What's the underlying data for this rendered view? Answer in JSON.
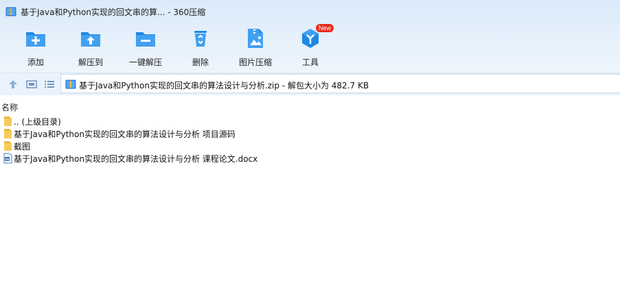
{
  "window": {
    "title": "基于Java和Python实现的回文串的算... - 360压缩"
  },
  "toolbar": {
    "items": [
      {
        "label": "添加",
        "icon": "add-icon"
      },
      {
        "label": "解压到",
        "icon": "extract-to-icon"
      },
      {
        "label": "一键解压",
        "icon": "one-click-extract-icon"
      },
      {
        "label": "删除",
        "icon": "delete-icon"
      },
      {
        "label": "图片压缩",
        "icon": "image-compress-icon"
      },
      {
        "label": "工具",
        "icon": "tools-icon",
        "badge": "New"
      }
    ]
  },
  "address": {
    "text": "基于Java和Python实现的回文串的算法设计与分析.zip - 解包大小为 482.7 KB"
  },
  "columns": {
    "name": "名称"
  },
  "files": [
    {
      "name": ".. (上级目录)",
      "type": "folder"
    },
    {
      "name": "基于Java和Python实现的回文串的算法设计与分析 项目源码",
      "type": "folder"
    },
    {
      "name": "截图",
      "type": "folder"
    },
    {
      "name": "基于Java和Python实现的回文串的算法设计与分析 课程论文.docx",
      "type": "docx"
    }
  ],
  "colors": {
    "accent": "#1e88e5",
    "folder": "#f6cc5b",
    "badge": "#ee2a1b"
  }
}
